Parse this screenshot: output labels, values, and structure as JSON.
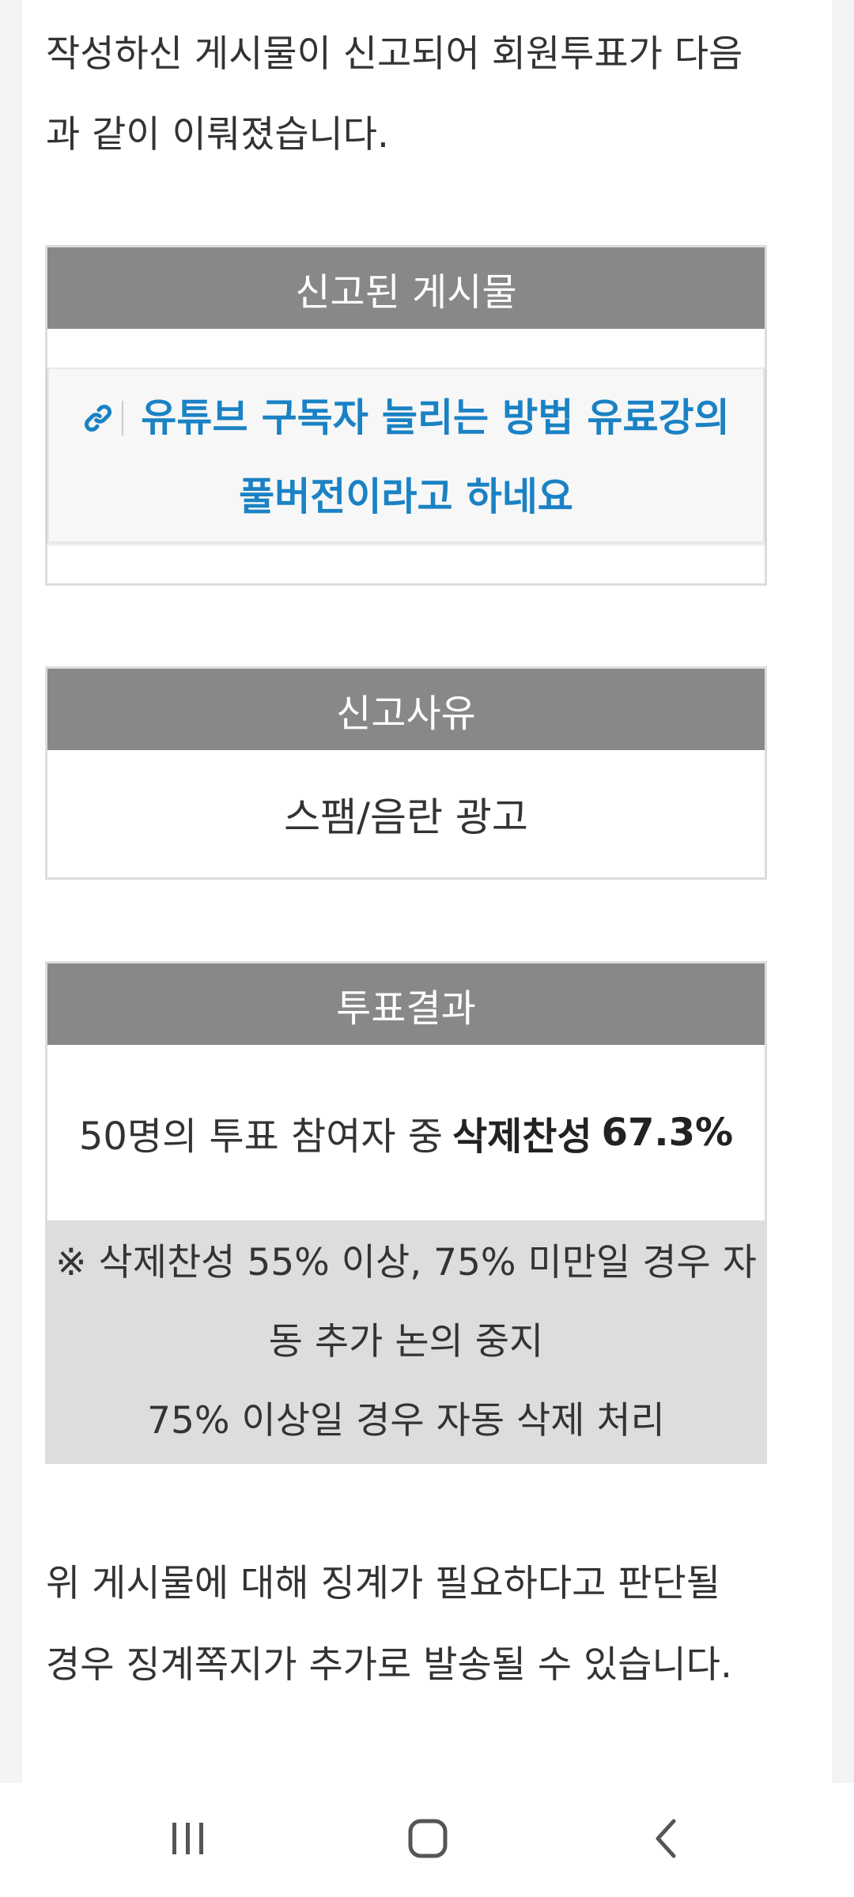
{
  "intro": {
    "line1": "작성하신 게시물이 신고되어 회원투표가 다음",
    "line2": "과 같이 이뤄졌습니다."
  },
  "reported_post": {
    "header": "신고된 게시물",
    "icon": "link-icon",
    "title_line1": "유튜브 구독자 늘리는 방법 유료강의",
    "title_line2": "풀버전이라고 하네요"
  },
  "report_reason": {
    "header": "신고사유",
    "value": "스팸/음란 광고"
  },
  "vote_result": {
    "header": "투표결과",
    "summary_prefix": "50명의 투표 참여자 중",
    "summary_label": "삭제찬성",
    "summary_value": "67.3%",
    "note_line1": "※ 삭제찬성 55% 이상, 75% 미만일 경우 자",
    "note_line2": "동 추가 논의 중지",
    "note_line3": "75% 이상일 경우 자동 삭제 처리"
  },
  "outro": {
    "line1": "위 게시물에 대해 징계가 필요하다고 판단될",
    "line2": "경우 징계쪽지가 추가로 발송될 수 있습니다."
  },
  "navbar": {
    "recents_icon": "recent-apps-icon",
    "home_icon": "home-icon",
    "back_icon": "back-icon"
  },
  "colors": {
    "header_bg": "#888888",
    "link": "#1a82c4",
    "note_bg": "#dddddd"
  }
}
